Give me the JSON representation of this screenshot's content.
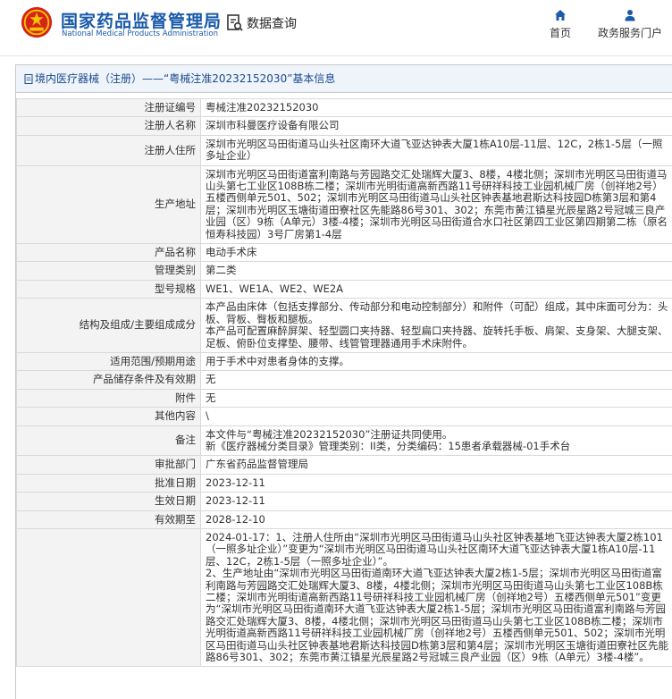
{
  "header": {
    "org_name_cn": "国家药品监督管理局",
    "org_name_en": "National Medical Products Administration",
    "query_label": "数据查询",
    "nav": [
      {
        "label": "首页",
        "icon": "home-icon"
      },
      {
        "label": "政务服务门户",
        "icon": "user-icon"
      }
    ]
  },
  "panel": {
    "breadcrumb": "境内医疗器械（注册）——“粤械注准20232152030”基本信息"
  },
  "rows": [
    {
      "label": "注册证编号",
      "value": "粤械注准20232152030"
    },
    {
      "label": "注册人名称",
      "value": "深圳市科曼医疗设备有限公司"
    },
    {
      "label": "注册人住所",
      "value": "深圳市光明区马田街道马山头社区南环大道飞亚达钟表大厦1栋A10层-11层、12C，2栋1-5层（一照多址企业）"
    },
    {
      "label": "生产地址",
      "value": "深圳市光明区马田街道富利南路与芳园路交汇处瑞辉大厦3、8楼，4楼北侧；深圳市光明区马田街道马山头第七工业区108B栋二楼；深圳市光明街道高新西路11号研祥科技工业园机械厂房（创祥地2号）五楼西侧单元501、502；深圳市光明区马田街道马山头社区钟表基地君斯达科技园D栋第3层和第4层；深圳市光明区玉塘街道田寮社区先能路86号301、302；东莞市黄江镇星光辰星路2号冠城三良产业园（区）9栋（A单元）3楼-4楼；深圳市光明区马田街道合水口社区第四工业区第四期第二栋（原名恒寿科技园）3号厂房第1-4层"
    },
    {
      "label": "产品名称",
      "value": "电动手术床"
    },
    {
      "label": "管理类别",
      "value": "第二类"
    },
    {
      "label": "型号规格",
      "value": "WE1、WE1A、WE2、WE2A"
    },
    {
      "label": "结构及组成/主要组成成分",
      "value": "本产品由床体（包括支撑部分、传动部分和电动控制部分）和附件（可配）组成，其中床面可分为：头板、背板、臀板和腿板。\n本产品可配置麻醉屏架、轻型圆口夹持器、轻型扁口夹持器、旋转托手板、肩架、支身架、大腿支架、足板、俯卧位支撑垫、腰带、线管管理器通用手术床附件。"
    },
    {
      "label": "适用范围/预期用途",
      "value": "用于手术中对患者身体的支撑。"
    },
    {
      "label": "产品储存条件及有效期",
      "value": "无"
    },
    {
      "label": "附件",
      "value": "无"
    },
    {
      "label": "其他内容",
      "value": "\\"
    },
    {
      "label": "备注",
      "value": "本文件与“粤械注准20232152030”注册证共同使用。\n新《医疗器械分类目录》管理类别：II类，分类编码：15患者承载器械-01手术台"
    },
    {
      "label": "审批部门",
      "value": "广东省药品监督管理局"
    },
    {
      "label": "批准日期",
      "value": "2023-12-11"
    },
    {
      "label": "生效日期",
      "value": "2023-12-11"
    },
    {
      "label": "有效期至",
      "value": "2028-12-10"
    },
    {
      "label": "",
      "value": "2024-01-17：1、注册人住所由“深圳市光明区马田街道马山头社区钟表基地飞亚达钟表大厦2栋101（一照多址企业）”变更为“深圳市光明区马田街道马山头社区南环大道飞亚达钟表大厦1栋A10层-11层、12C，2栋1-5层（一照多址企业）”。\n2、生产地址由“深圳市光明区马田街道南环大道飞亚达钟表大厦2栋1-5层；深圳市光明区马田街道富利南路与芳园路交汇处瑞辉大厦3、8楼，4楼北侧；深圳市光明区马田街道马山头第七工业区108B栋二楼；深圳市光明街道高新西路11号研祥科技工业园机械厂房（创祥地2号）五楼西侧单元501”变更为“深圳市光明区马田街道南环大道飞亚达钟表大厦2栋1-5层；深圳市光明区马田街道富利南路与芳园路交汇处瑞辉大厦3、8楼，4楼北侧；深圳市光明区马田街道马山头第七工业区108B栋二楼；深圳市光明街道高新西路11号研祥科技工业园机械厂房（创祥地2号）五楼西侧单元501、502；深圳市光明区马田街道马山头社区钟表基地君斯达科技园D栋第3层和第4层；深圳市光明区玉塘街道田寮社区先能路86号301、302；东莞市黄江镇星光辰星路2号冠城三良产业园（区）9栋（A单元）3楼-4楼”。"
    }
  ]
}
